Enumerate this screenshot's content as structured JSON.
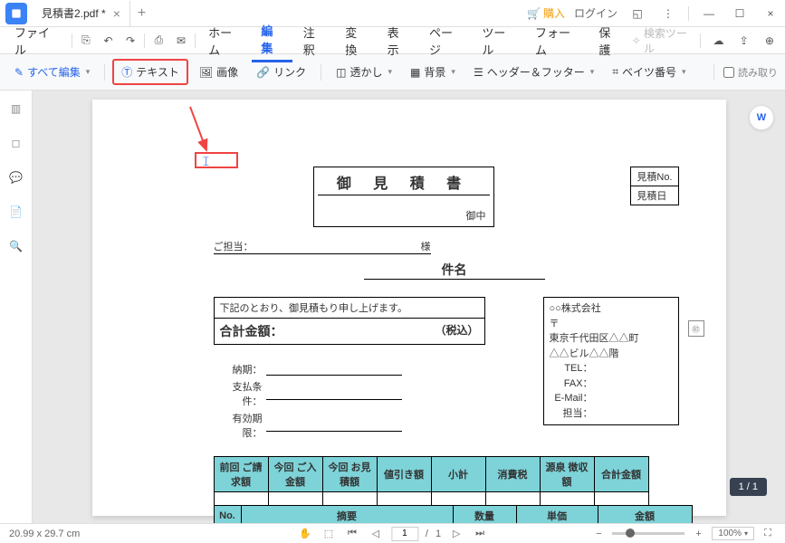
{
  "titlebar": {
    "tab_name": "見積書2.pdf *",
    "purchase": "購入",
    "login": "ログイン"
  },
  "menubar": {
    "file": "ファイル",
    "items": [
      "ホーム",
      "編集",
      "注釈",
      "変換",
      "表示",
      "ページ",
      "ツール",
      "フォーム",
      "保護"
    ],
    "search": "検索ツール"
  },
  "toolbar": {
    "edit_all": "すべて編集",
    "text": "テキスト",
    "image": "画像",
    "link": "リンク",
    "watermark": "透かし",
    "background": "背景",
    "header_footer": "ヘッダー＆フッター",
    "bates": "ベイツ番号",
    "ocr": "読み取り"
  },
  "document": {
    "title": "御 見 積 書",
    "onchu": "御中",
    "est_no_label": "見積No.",
    "est_date_label": "見積日",
    "contact_label": "ご担当：",
    "sama": "様",
    "subject": "件名",
    "desc": "下記のとおり、御見積もり申し上げます。",
    "total_label": "合計金額：",
    "tax": "（税込）",
    "terms": {
      "delivery": "納期：",
      "payment": "支払条件：",
      "expiry": "有効期限："
    },
    "company": {
      "name": "○○株式会社",
      "postal": "〒",
      "addr1": "東京千代田区△△町",
      "addr2": "△△ビル△△階",
      "tel": "TEL：",
      "fax": "FAX：",
      "email": "E-Mail：",
      "contact": "担当："
    },
    "table1": [
      "前回\nご請求額",
      "今回\nご入金額",
      "今回\nお見積額",
      "値引き額",
      "小計",
      "消費税",
      "源泉\n徴収額",
      "合計金額"
    ],
    "table2": {
      "no": "No.",
      "desc": "摘要",
      "qty": "数量",
      "unit": "単価",
      "amount": "金額"
    }
  },
  "status": {
    "dims": "20.99 x 29.7 cm",
    "page_current": "1",
    "page_total": "1",
    "page_indicator": "1 / 1",
    "zoom": "100%"
  }
}
